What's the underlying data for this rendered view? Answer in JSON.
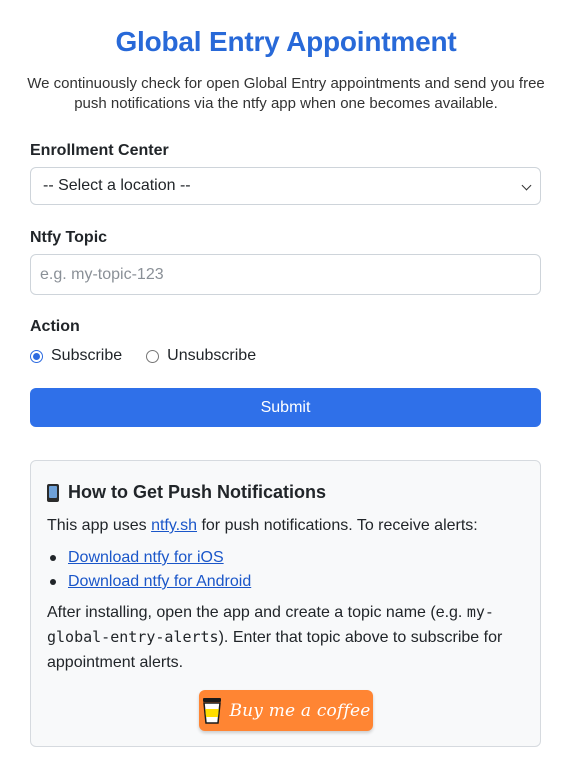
{
  "page": {
    "title": "Global Entry Appointment",
    "subtitle": "We continuously check for open Global Entry appointments and send you free push notifications via the ntfy app when one becomes available."
  },
  "form": {
    "enrollment_label": "Enrollment Center",
    "location_select": {
      "selected": "-- Select a location --"
    },
    "topic_label": "Ntfy Topic",
    "topic_input": {
      "value": "",
      "placeholder": "e.g. my-topic-123"
    },
    "action_label": "Action",
    "actions": [
      {
        "label": "Subscribe",
        "checked": true
      },
      {
        "label": "Unsubscribe",
        "checked": false
      }
    ],
    "submit_label": "Submit"
  },
  "help": {
    "heading": "How to Get Push Notifications",
    "heading_icon": "mobile-phone-icon",
    "intro_before": "This app uses ",
    "intro_link": "ntfy.sh",
    "intro_after": " for push notifications. To receive alerts:",
    "links": [
      "Download ntfy for iOS",
      "Download ntfy for Android"
    ],
    "after_before": "After installing, open the app and create a topic name (e.g. ",
    "after_code": "my-global-entry-alerts",
    "after_after": "). Enter that topic above to subscribe for appointment alerts.",
    "coffee_label": "Buy me a coffee"
  },
  "colors": {
    "accent": "#2f70e9",
    "title": "#2869d8",
    "link": "#1a56c9",
    "coffee": "#ff8533"
  }
}
